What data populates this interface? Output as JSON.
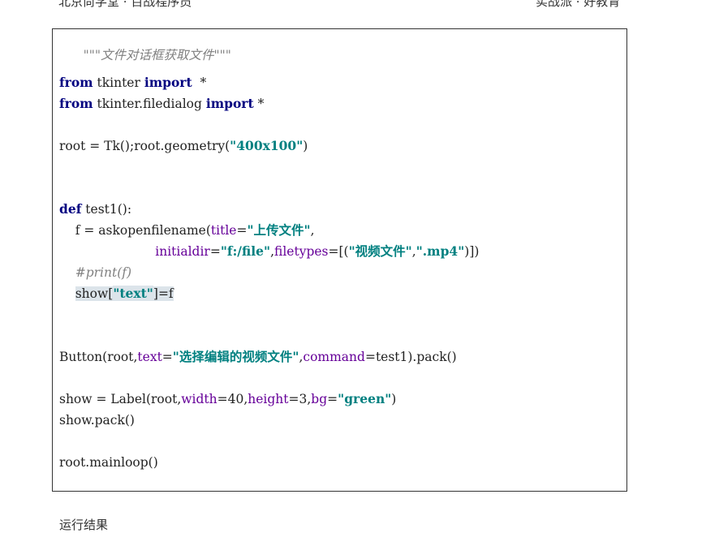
{
  "header": {
    "left": "北京尚学堂 · 百战程序员",
    "right": "实战派 · 好教育"
  },
  "code": {
    "line1": "\"\"\"文件对话框获取文件\"\"\"",
    "line2_kw1": "from",
    "line2_mod": " tkinter ",
    "line2_kw2": "import",
    "line2_rest": "  *",
    "line3_kw1": "from",
    "line3_mod": " tkinter.filedialog ",
    "line3_kw2": "import",
    "line3_rest": " *",
    "line4_a": "root = Tk();root.geometry(",
    "line4_str": "\"400x100\"",
    "line4_b": ")",
    "line5_kw": "def",
    "line5_rest": " test1():",
    "line6_a": "    f = askopenfilename(",
    "line6_param": "title",
    "line6_eq": "=",
    "line6_str": "\"上传文件\"",
    "line6_b": ",",
    "line7_indent": "                        ",
    "line7_param1": "initialdir",
    "line7_eq1": "=",
    "line7_str1": "\"f:/file\"",
    "line7_comma": ",",
    "line7_param2": "filetypes",
    "line7_eq2": "=[(",
    "line7_str2": "\"视频文件\"",
    "line7_comma2": ",",
    "line7_str3": "\".mp4\"",
    "line7_end": ")])",
    "line8_indent": "    ",
    "line8_comment": "#print(f)",
    "line9_indent": "    ",
    "line9_a": "show[",
    "line9_str": "\"text\"",
    "line9_b": "]=f",
    "line10_a": "Button(root,",
    "line10_param1": "text",
    "line10_eq1": "=",
    "line10_str": "\"选择编辑的视频文件\"",
    "line10_comma": ",",
    "line10_param2": "command",
    "line10_rest": "=test1).pack()",
    "line11_a": "show = Label(root,",
    "line11_param1": "width",
    "line11_v1": "=40,",
    "line11_param2": "height",
    "line11_v2": "=3,",
    "line11_param3": "bg",
    "line11_eq3": "=",
    "line11_str": "\"green\"",
    "line11_end": ")",
    "line12": "show.pack()",
    "line13": "root.mainloop()"
  },
  "footer": {
    "text": "运行结果"
  }
}
